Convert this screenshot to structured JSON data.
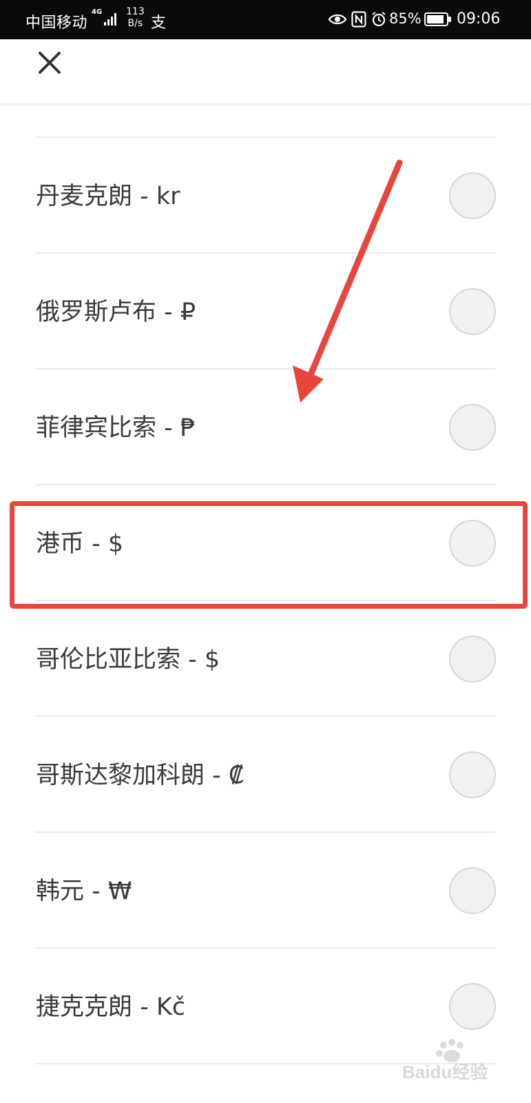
{
  "status_bar": {
    "carrier": "中国移动",
    "network_type": "4G",
    "speed_value": "113",
    "speed_unit": "B/s",
    "extra_icon": "支",
    "battery": "85%",
    "time": "09:06",
    "icons": [
      "signal-icon",
      "eye-icon",
      "nfc-icon",
      "alarm-icon",
      "battery-icon"
    ]
  },
  "header": {
    "close_icon": "close-icon"
  },
  "currency_list": [
    {
      "label": "丹麦克朗 - kr",
      "selected": false
    },
    {
      "label": "俄罗斯卢布 - ₽",
      "selected": false
    },
    {
      "label": "菲律宾比索 - ₱",
      "selected": false
    },
    {
      "label": "港币 - $",
      "selected": false
    },
    {
      "label": "哥伦比亚比索 - $",
      "selected": false
    },
    {
      "label": "哥斯达黎加科朗 - ₡",
      "selected": false
    },
    {
      "label": "韩元 - ₩",
      "selected": false
    },
    {
      "label": "捷克克朗 - Kč",
      "selected": false
    }
  ],
  "annotation": {
    "color": "#e8453c",
    "highlighted_item": "港币 - $"
  },
  "watermark": {
    "text": "Baidu经验"
  }
}
